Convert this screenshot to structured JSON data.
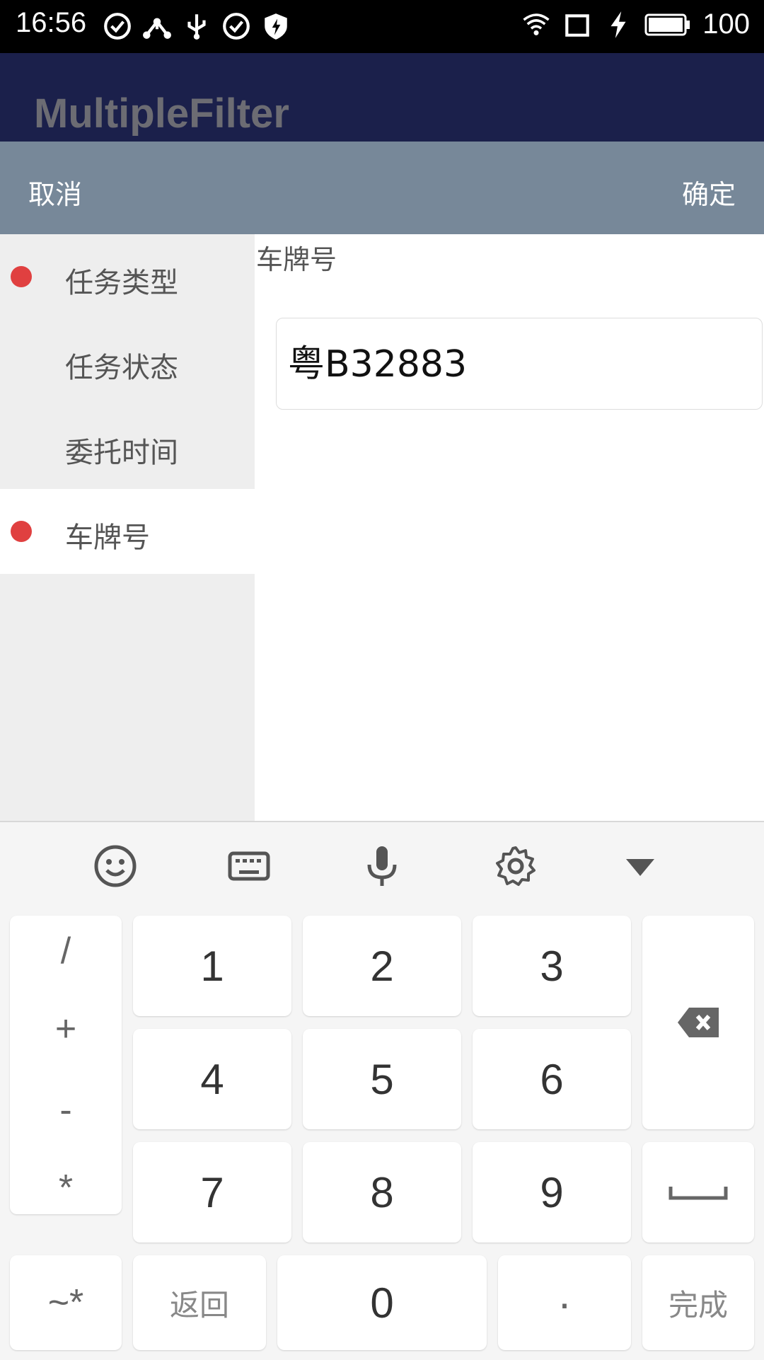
{
  "status_bar": {
    "time": "16:56",
    "battery": "100"
  },
  "app_bar": {
    "title": "MultipleFilter"
  },
  "action_bar": {
    "cancel_label": "取消",
    "confirm_label": "确定"
  },
  "categories": [
    {
      "label": "任务类型",
      "has_dot": true
    },
    {
      "label": "任务状态",
      "has_dot": false
    },
    {
      "label": "委托时间",
      "has_dot": false
    },
    {
      "label": "车牌号",
      "has_dot": true,
      "selected": true
    }
  ],
  "detail": {
    "section_title": "车牌号",
    "plate_value": "粤B32883"
  },
  "keyboard": {
    "toolbar_icons": [
      "emoji-icon",
      "keyboard-icon",
      "microphone-icon",
      "settings-icon",
      "hide-keyboard-icon"
    ],
    "symbols": [
      "/",
      "+",
      "-",
      "*"
    ],
    "digits": [
      "1",
      "2",
      "3",
      "4",
      "5",
      "6",
      "7",
      "8",
      "9"
    ],
    "zero": "0",
    "more_symbols": "~*",
    "back_label": "返回",
    "dot": "·",
    "done_label": "完成"
  },
  "colors": {
    "status_bar": "#000000",
    "app_bar": "#1b204b",
    "action_bar": "#778899",
    "dot": "#e04040"
  }
}
